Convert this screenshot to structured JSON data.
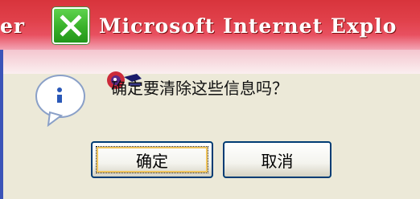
{
  "dialog": {
    "title_left_fragment": "er",
    "title": "Microsoft Internet Explo",
    "message": "确定要清除这些信息吗？",
    "ok_label": "确定",
    "cancel_label": "取消"
  },
  "icons": {
    "close": "close-icon",
    "info": "info-balloon-icon",
    "mascot": "mascot-icon"
  },
  "colors": {
    "titlebar": "#e0404a",
    "close_button": "#38b12a",
    "dialog_background": "#ece9d8",
    "button_border": "#003c74"
  }
}
